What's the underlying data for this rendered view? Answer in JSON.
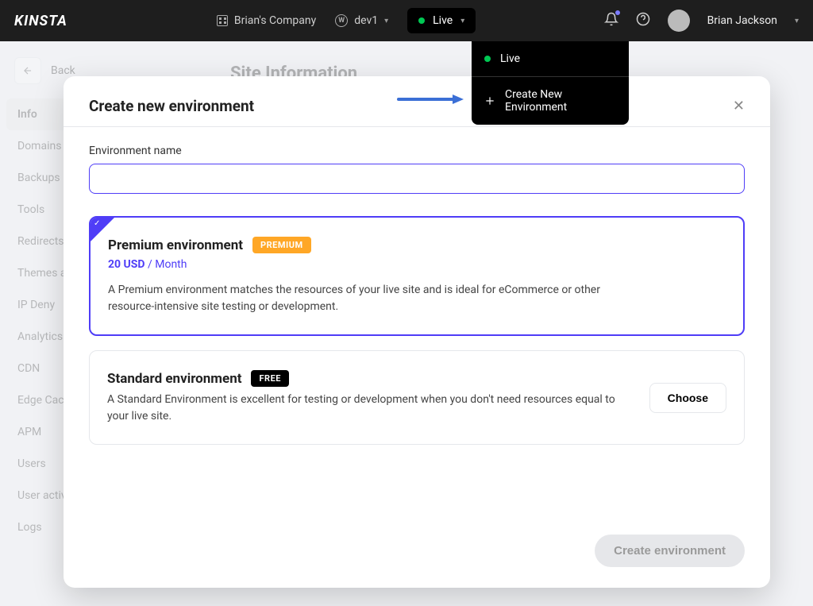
{
  "topbar": {
    "logo": "KINSTA",
    "company": "Brian's Company",
    "site": "dev1",
    "env_button": "Live",
    "user_name": "Brian Jackson"
  },
  "env_dropdown": {
    "live": "Live",
    "create": "Create New Environment"
  },
  "sidebar": {
    "back": "Back",
    "items": [
      "Info",
      "Domains",
      "Backups",
      "Tools",
      "Redirects",
      "Themes and Plugins",
      "IP Deny",
      "Analytics",
      "CDN",
      "Edge Caching",
      "APM",
      "Users",
      "User activity",
      "Logs"
    ],
    "active_index": 0
  },
  "page": {
    "title": "Site Information"
  },
  "modal": {
    "title": "Create new environment",
    "close": "✕",
    "field_label": "Environment name",
    "field_value": "",
    "premium": {
      "title": "Premium environment",
      "badge": "PREMIUM",
      "price_value": "20 USD",
      "price_unit": "/ Month",
      "desc": "A Premium environment matches the resources of your live site and is ideal for eCommerce or other resource-intensive site testing or development."
    },
    "standard": {
      "title": "Standard environment",
      "badge": "FREE",
      "desc": "A Standard Environment is excellent for testing or development when you don't need resources equal to your live site.",
      "choose": "Choose"
    },
    "submit": "Create environment"
  }
}
